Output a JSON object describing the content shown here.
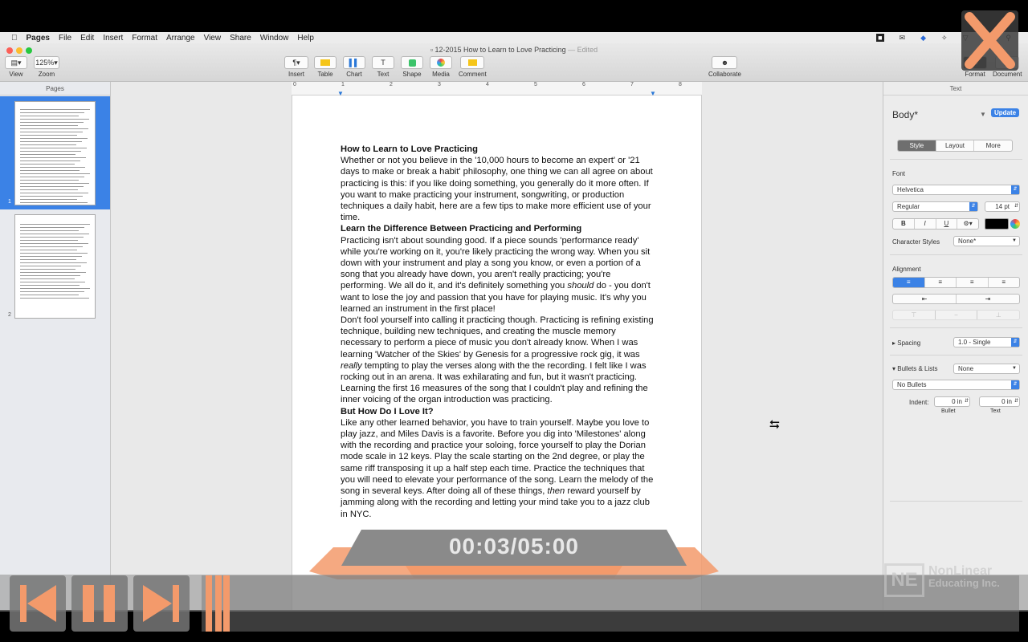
{
  "menubar": {
    "app": "Pages",
    "items": [
      "File",
      "Edit",
      "Insert",
      "Format",
      "Arrange",
      "View",
      "Share",
      "Window",
      "Help"
    ]
  },
  "window": {
    "title": "12-2015 How to Learn to Love Practicing",
    "edited": "— Edited"
  },
  "toolbar": {
    "view": "View",
    "zoom": "Zoom",
    "zoom_value": "125%",
    "insert": "Insert",
    "table": "Table",
    "chart": "Chart",
    "text": "Text",
    "shape": "Shape",
    "media": "Media",
    "comment": "Comment",
    "collaborate": "Collaborate",
    "format": "Format",
    "document": "Document"
  },
  "sidebar": {
    "header": "Pages",
    "pages": [
      "1",
      "2"
    ]
  },
  "ruler": {
    "ticks": [
      "0",
      "1",
      "2",
      "3",
      "4",
      "5",
      "6",
      "7",
      "8"
    ]
  },
  "document": {
    "title": "How to Learn to Love Practicing",
    "p1": "Whether or not you believe in the '10,000 hours to become an expert' or '21 days to make or break a habit' philosophy, one thing we can all agree on about practicing is this: if you like doing something, you generally do it more often. If you want to make practicing your instrument, songwriting, or production techniques a daily habit, here are a few tips to make more efficient use of your time.",
    "h2": "Learn the Difference Between Practicing and Performing",
    "p2a": "Practicing isn't about sounding good. If a piece sounds 'performance ready' while you're working on it, you're likely practicing the wrong way. When you sit down with your instrument and play a song you know, or even a portion of a song that you already have down, you aren't really practicing; you're performing. We all do it, and it's definitely something you ",
    "p2em": "should",
    "p2b": " do - you don't want to lose the joy and passion that you have for playing music. It's why you learned an instrument in the first place!",
    "p3a": "Don't fool yourself into calling it practicing though. Practicing is refining existing technique, building new techniques, and creating the muscle memory necessary to perform a piece of music you don't already know. When I was learning 'Watcher of the Skies' by Genesis for a progressive rock gig, it was ",
    "p3em": "really",
    "p3b": " tempting to play the verses along with the the recording. I felt like I was rocking out in an arena. It was exhilarating and fun, but it wasn't practicing. Learning the first 16 measures of the song that I couldn't play and refining the inner voicing of the organ introduction was practicing.",
    "h3": "But How Do I Love It?",
    "p4a": "Like any other learned behavior, you have to train yourself. Maybe you love to play jazz, and Miles Davis is a favorite. Before you dig into 'Milestones' along with the recording and practice your soloing, force yourself to play the Dorian mode scale in 12 keys. Play the scale starting on the 2nd degree, or play the same riff transposing it up a half step each time. Practice the techniques that you will need to elevate your performance of the song. Learn the melody of the song in several keys. After doing all of these things, ",
    "p4em": "then",
    "p4b": " reward yourself by jamming along with the recording and letting your mind take you to a jazz club in NYC."
  },
  "inspector": {
    "header": "Text",
    "style_name": "Body*",
    "update": "Update",
    "tabs": [
      "Style",
      "Layout",
      "More"
    ],
    "font_label": "Font",
    "font": "Helvetica",
    "weight": "Regular",
    "size": "14 pt",
    "char_styles_label": "Character Styles",
    "char_styles": "None*",
    "alignment_label": "Alignment",
    "spacing_label": "Spacing",
    "spacing": "1.0 - Single",
    "bullets_label": "Bullets & Lists",
    "bullets": "None",
    "bullets_style": "No Bullets",
    "indent_label": "Indent:",
    "bullet_indent": "0 in",
    "text_indent": "0 in",
    "bullet_cap": "Bullet",
    "text_cap": "Text"
  },
  "player": {
    "timer": "00:03/05:00",
    "watermark_1": "NonLinear",
    "watermark_2": "Educating Inc."
  },
  "colors": {
    "accent": "#3b82e6",
    "player_orange": "#f39a6b"
  }
}
